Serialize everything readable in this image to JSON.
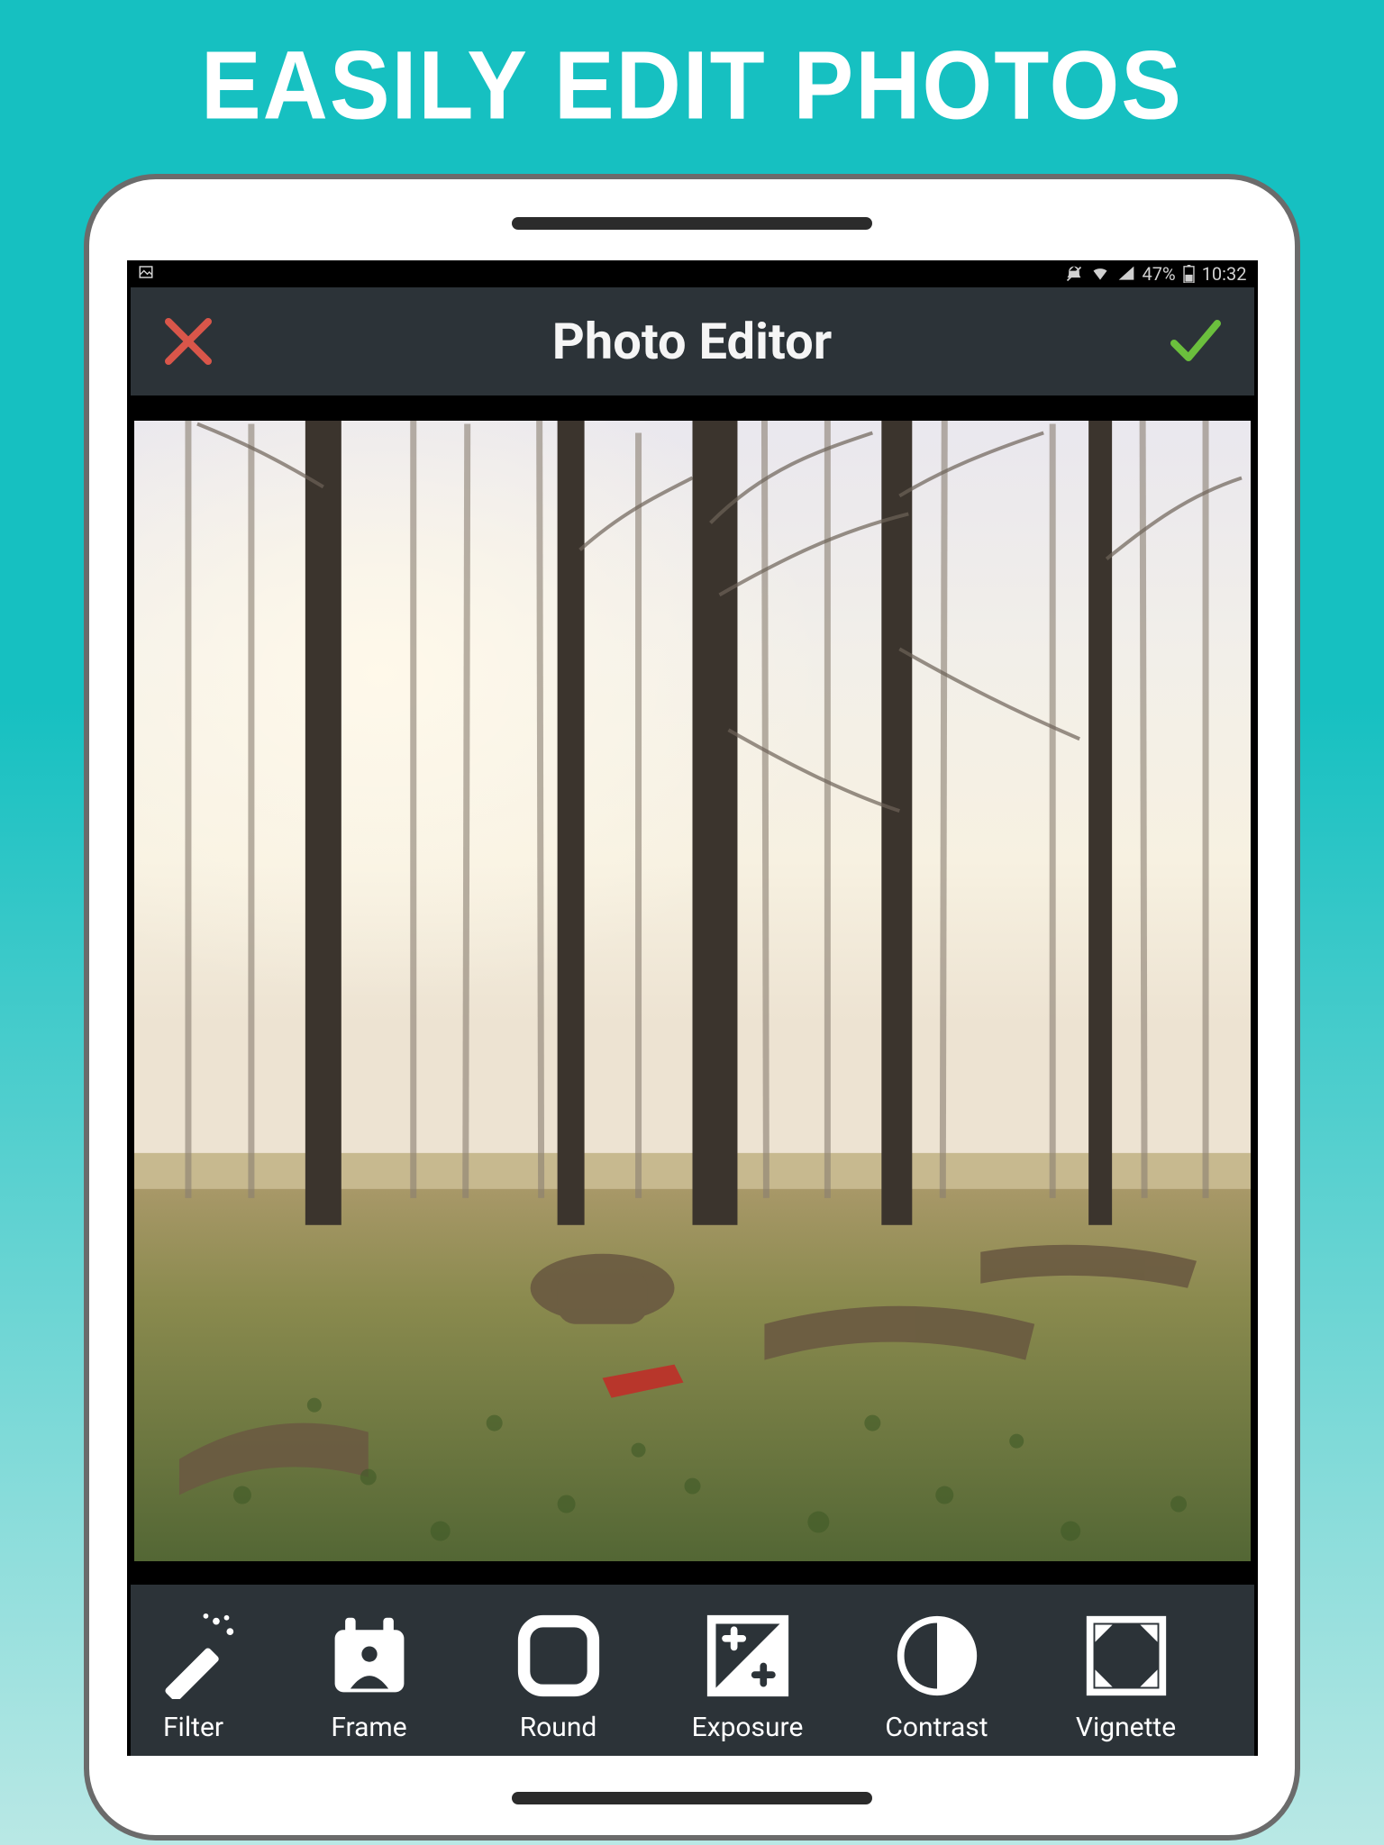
{
  "promo": {
    "headline": "EASILY EDIT PHOTOS"
  },
  "status_bar": {
    "battery_pct": "47%",
    "time": "10:32"
  },
  "app_bar": {
    "title": "Photo Editor"
  },
  "tools": [
    {
      "label": "Filter",
      "icon": "wand-icon"
    },
    {
      "label": "Frame",
      "icon": "frame-icon"
    },
    {
      "label": "Round",
      "icon": "rounded-square-icon"
    },
    {
      "label": "Exposure",
      "icon": "exposure-icon"
    },
    {
      "label": "Contrast",
      "icon": "contrast-icon"
    },
    {
      "label": "Vignette",
      "icon": "vignette-icon"
    }
  ]
}
